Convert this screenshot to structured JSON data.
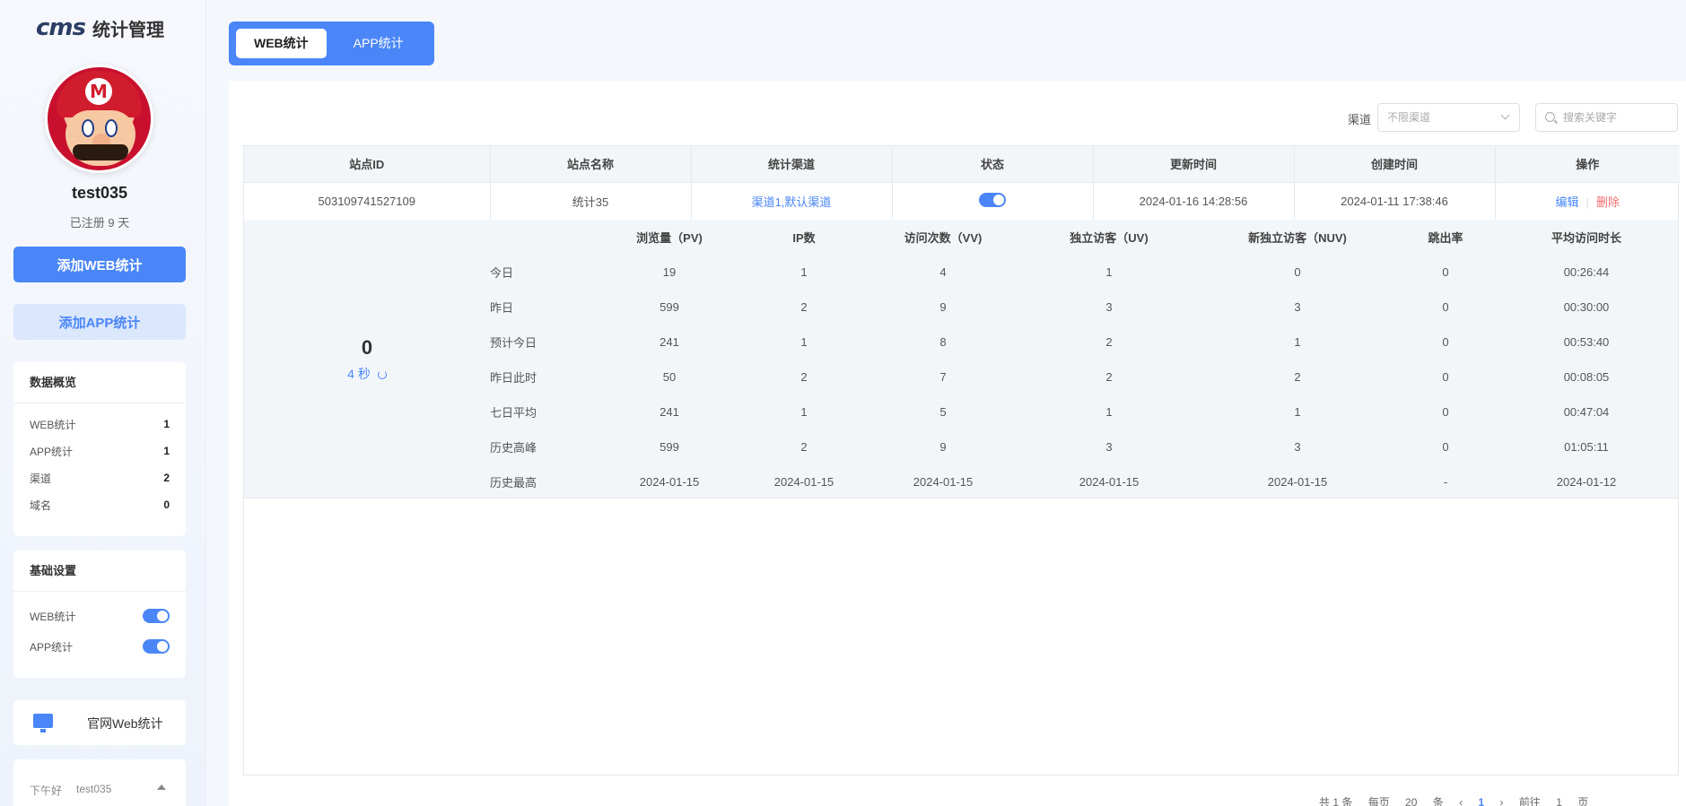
{
  "brand": {
    "logo": "cms",
    "title": "统计管理"
  },
  "user": {
    "name": "test035",
    "registered": "已注册 9 天"
  },
  "actions": {
    "add_web": "添加WEB统计",
    "add_app": "添加APP统计"
  },
  "overview": {
    "title": "数据概览",
    "rows": [
      {
        "label": "WEB统计",
        "value": "1"
      },
      {
        "label": "APP统计",
        "value": "1"
      },
      {
        "label": "渠道",
        "value": "2"
      },
      {
        "label": "域名",
        "value": "0"
      }
    ]
  },
  "settings": {
    "title": "基础设置",
    "rows": [
      {
        "label": "WEB统计",
        "enabled": true
      },
      {
        "label": "APP统计",
        "enabled": true
      }
    ]
  },
  "site_link": {
    "label": "官网Web统计"
  },
  "greeting": {
    "text": "下午好",
    "user": "test035"
  },
  "tabs": [
    {
      "label": "WEB统计",
      "active": true
    },
    {
      "label": "APP统计",
      "active": false
    }
  ],
  "filter": {
    "label": "渠道",
    "select_value": "不限渠道",
    "search_placeholder": "搜索关键字"
  },
  "table": {
    "headers": [
      "站点ID",
      "站点名称",
      "统计渠道",
      "状态",
      "更新时间",
      "创建时间",
      "操作"
    ],
    "row": {
      "id": "503109741527109",
      "name": "统计35",
      "channel": "渠道1,默认渠道",
      "status_on": true,
      "updated": "2024-01-16 14:28:56",
      "created": "2024-01-11 17:38:46",
      "edit": "编辑",
      "delete": "删除"
    }
  },
  "realtime": {
    "count": "0",
    "refresh": "4 秒"
  },
  "stats": {
    "headers": [
      "",
      "浏览量（PV)",
      "IP数",
      "访问次数（VV)",
      "独立访客（UV)",
      "新独立访客（NUV)",
      "跳出率",
      "平均访问时长"
    ],
    "rows": [
      [
        "今日",
        "19",
        "1",
        "4",
        "1",
        "0",
        "0",
        "00:26:44"
      ],
      [
        "昨日",
        "599",
        "2",
        "9",
        "3",
        "3",
        "0",
        "00:30:00"
      ],
      [
        "预计今日",
        "241",
        "1",
        "8",
        "2",
        "1",
        "0",
        "00:53:40"
      ],
      [
        "昨日此时",
        "50",
        "2",
        "7",
        "2",
        "2",
        "0",
        "00:08:05"
      ],
      [
        "七日平均",
        "241",
        "1",
        "5",
        "1",
        "1",
        "0",
        "00:47:04"
      ],
      [
        "历史高峰",
        "599",
        "2",
        "9",
        "3",
        "3",
        "0",
        "01:05:11"
      ],
      [
        "历史最高",
        "2024-01-15",
        "2024-01-15",
        "2024-01-15",
        "2024-01-15",
        "2024-01-15",
        "-",
        "2024-01-12"
      ]
    ]
  },
  "pager": {
    "total": "共 1 条",
    "per_page_label": "每页",
    "per_page": "20",
    "unit": "条",
    "current": "1",
    "goto": "前往",
    "goto_value": "1",
    "page_unit": "页"
  },
  "colors": {
    "accent": "#4a86f7",
    "danger": "#f56c6c"
  }
}
